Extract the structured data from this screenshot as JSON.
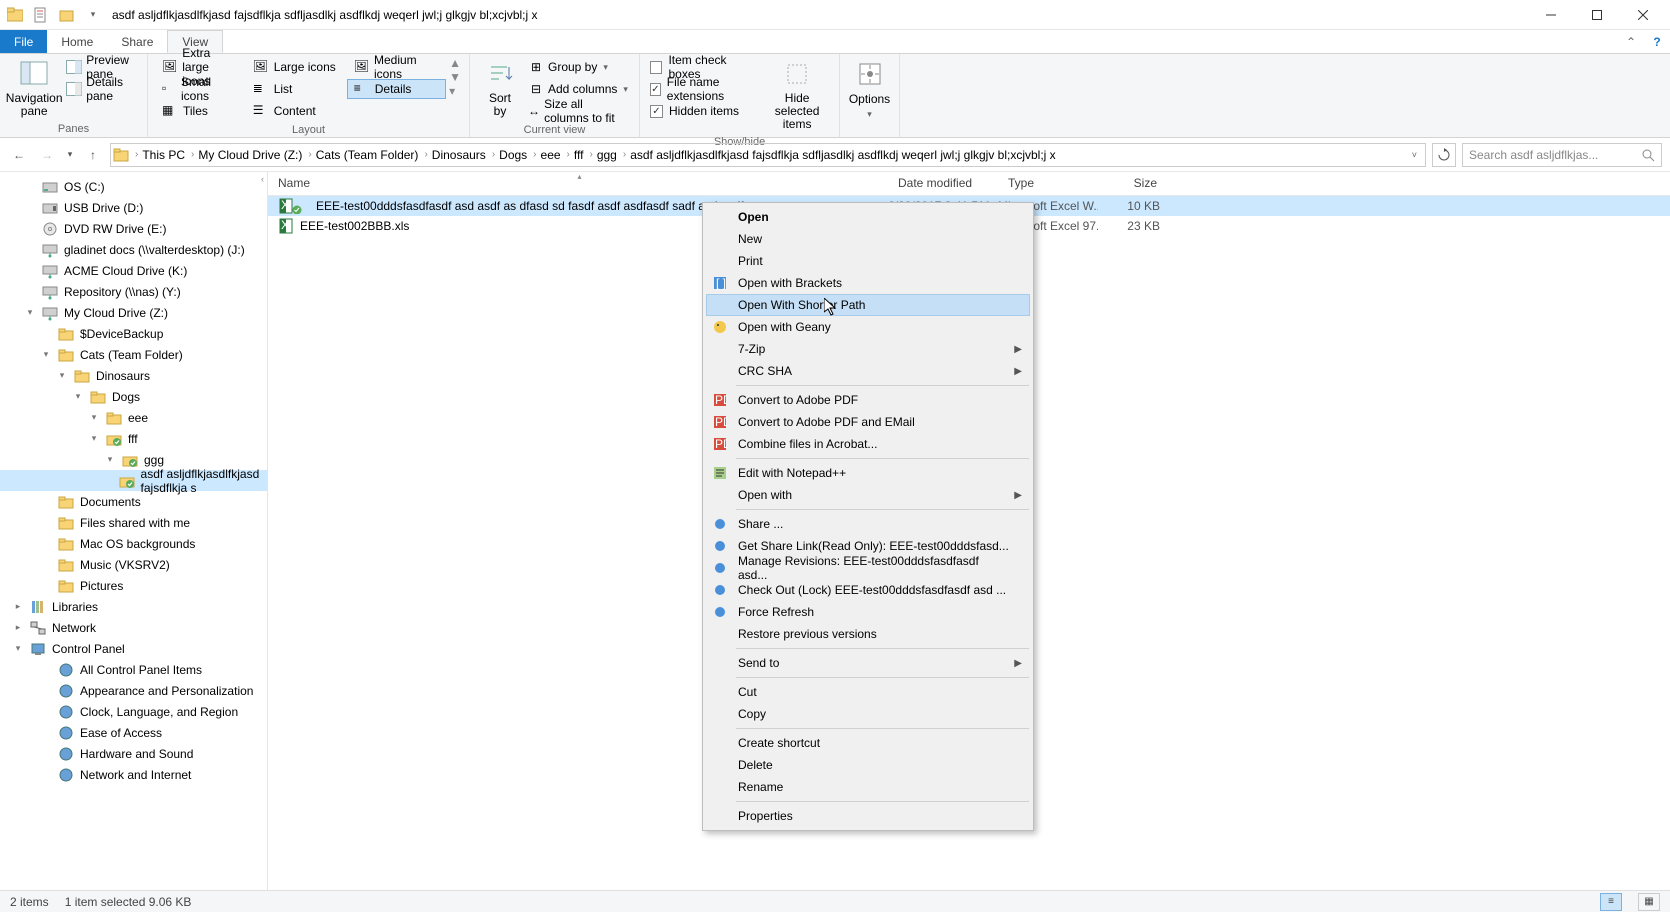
{
  "window": {
    "title": "asdf asljdflkjasdlfkjasd fajsdflkja sdfljasdlkj asdflkdj weqerl jwl;j glkgjv bl;xcjvbl;j x"
  },
  "tabs": {
    "file": "File",
    "home": "Home",
    "share": "Share",
    "view": "View"
  },
  "ribbon": {
    "panes_group": "Panes",
    "nav_pane": "Navigation\npane",
    "preview_pane": "Preview pane",
    "details_pane": "Details pane",
    "layout_group": "Layout",
    "layout": {
      "xl": "Extra large icons",
      "lg": "Large icons",
      "md": "Medium icons",
      "sm": "Small icons",
      "list": "List",
      "details": "Details",
      "tiles": "Tiles",
      "content": "Content"
    },
    "currentview_group": "Current view",
    "sortby": "Sort\nby",
    "groupby": "Group by",
    "addcolumns": "Add columns",
    "sizecols": "Size all columns to fit",
    "showhide_group": "Show/hide",
    "itemcheck": "Item check boxes",
    "fileext": "File name extensions",
    "hiddenitems": "Hidden items",
    "hidesel": "Hide selected\nitems",
    "options": "Options"
  },
  "breadcrumbs": [
    "This PC",
    "My Cloud Drive (Z:)",
    "Cats (Team Folder)",
    "Dinosaurs",
    "Dogs",
    "eee",
    "fff",
    "ggg",
    "asdf asljdflkjasdlfkjasd fajsdflkja sdfljasdlkj asdflkdj weqerl jwl;j glkgjv bl;xcjvbl;j x"
  ],
  "search_placeholder": "Search asdf asljdflkjas...",
  "tree": [
    {
      "indent": 24,
      "exp": "",
      "icon": "disk",
      "label": "OS (C:)"
    },
    {
      "indent": 24,
      "exp": "",
      "icon": "usb",
      "label": "USB Drive (D:)"
    },
    {
      "indent": 24,
      "exp": "",
      "icon": "dvd",
      "label": "DVD RW Drive (E:)"
    },
    {
      "indent": 24,
      "exp": "",
      "icon": "netdrive",
      "label": "gladinet docs (\\\\valterdesktop) (J:)"
    },
    {
      "indent": 24,
      "exp": "",
      "icon": "netdrive",
      "label": "ACME Cloud Drive (K:)"
    },
    {
      "indent": 24,
      "exp": "",
      "icon": "netdrive",
      "label": "Repository (\\\\nas) (Y:)"
    },
    {
      "indent": 24,
      "exp": "▾",
      "icon": "netdrive",
      "label": "My Cloud Drive (Z:)"
    },
    {
      "indent": 40,
      "exp": "",
      "icon": "folder",
      "label": "$DeviceBackup"
    },
    {
      "indent": 40,
      "exp": "▾",
      "icon": "folder",
      "label": "Cats (Team Folder)"
    },
    {
      "indent": 56,
      "exp": "▾",
      "icon": "folder",
      "label": "Dinosaurs"
    },
    {
      "indent": 72,
      "exp": "▾",
      "icon": "folder",
      "label": "Dogs"
    },
    {
      "indent": 88,
      "exp": "▾",
      "icon": "folder",
      "label": "eee"
    },
    {
      "indent": 88,
      "exp": "▾",
      "icon": "sync-folder",
      "label": "fff"
    },
    {
      "indent": 104,
      "exp": "▾",
      "icon": "sync-folder",
      "label": "ggg"
    },
    {
      "indent": 104,
      "exp": "",
      "icon": "sync-folder",
      "label": "asdf asljdflkjasdlfkjasd fajsdflkja s",
      "selected": true
    },
    {
      "indent": 40,
      "exp": "",
      "icon": "folder",
      "label": "Documents"
    },
    {
      "indent": 40,
      "exp": "",
      "icon": "folder",
      "label": "Files shared with me"
    },
    {
      "indent": 40,
      "exp": "",
      "icon": "folder",
      "label": "Mac OS backgrounds"
    },
    {
      "indent": 40,
      "exp": "",
      "icon": "folder",
      "label": "Music (VKSRV2)"
    },
    {
      "indent": 40,
      "exp": "",
      "icon": "folder",
      "label": "Pictures"
    },
    {
      "indent": 12,
      "exp": "▸",
      "icon": "libraries",
      "label": "Libraries"
    },
    {
      "indent": 12,
      "exp": "▸",
      "icon": "network",
      "label": "Network"
    },
    {
      "indent": 12,
      "exp": "▾",
      "icon": "cp",
      "label": "Control Panel"
    },
    {
      "indent": 40,
      "exp": "",
      "icon": "cp-item",
      "label": "All Control Panel Items"
    },
    {
      "indent": 40,
      "exp": "",
      "icon": "cp-item",
      "label": "Appearance and Personalization"
    },
    {
      "indent": 40,
      "exp": "",
      "icon": "cp-item",
      "label": "Clock, Language, and Region"
    },
    {
      "indent": 40,
      "exp": "",
      "icon": "cp-item",
      "label": "Ease of Access"
    },
    {
      "indent": 40,
      "exp": "",
      "icon": "cp-item",
      "label": "Hardware and Sound"
    },
    {
      "indent": 40,
      "exp": "",
      "icon": "cp-item",
      "label": "Network and Internet"
    }
  ],
  "columns": {
    "name": "Name",
    "date": "Date modified",
    "type": "Type",
    "size": "Size"
  },
  "files": [
    {
      "name": "EEE-test00dddsfasdfasdf asd asdf as dfasd  sd fasdf asdf asdfasdf sadf asd asdf zxcvz",
      "date": "6/20/2017 3:41 PM",
      "type": "Microsoft Excel W...",
      "size": "10 KB",
      "selected": true
    },
    {
      "name": "EEE-test002BBB.xls",
      "date": "",
      "type": "Microsoft Excel 97...",
      "size": "23 KB"
    }
  ],
  "context_menu": [
    {
      "label": "Open",
      "bold": true
    },
    {
      "label": "New"
    },
    {
      "label": "Print"
    },
    {
      "label": "Open with Brackets",
      "icon": "brackets"
    },
    {
      "label": "Open With Shorter Path",
      "hover": true
    },
    {
      "label": "Open with Geany",
      "icon": "geany"
    },
    {
      "label": "7-Zip",
      "submenu": true
    },
    {
      "label": "CRC SHA",
      "submenu": true
    },
    {
      "sep": true
    },
    {
      "label": "Convert to Adobe PDF",
      "icon": "pdf"
    },
    {
      "label": "Convert to Adobe PDF and EMail",
      "icon": "pdf"
    },
    {
      "label": "Combine files in Acrobat...",
      "icon": "pdf"
    },
    {
      "sep": true
    },
    {
      "label": "Edit with Notepad++",
      "icon": "npp"
    },
    {
      "label": "Open with",
      "submenu": true
    },
    {
      "sep": true
    },
    {
      "label": "Share ...",
      "icon": "blue"
    },
    {
      "label": "Get Share Link(Read Only): EEE-test00dddsfasd...",
      "icon": "blue"
    },
    {
      "label": "Manage Revisions: EEE-test00dddsfasdfasdf asd...",
      "icon": "blue"
    },
    {
      "label": "Check Out (Lock) EEE-test00dddsfasdfasdf asd ...",
      "icon": "blue"
    },
    {
      "label": "Force Refresh",
      "icon": "blue"
    },
    {
      "label": "Restore previous versions"
    },
    {
      "sep": true
    },
    {
      "label": "Send to",
      "submenu": true
    },
    {
      "sep": true
    },
    {
      "label": "Cut"
    },
    {
      "label": "Copy"
    },
    {
      "sep": true
    },
    {
      "label": "Create shortcut"
    },
    {
      "label": "Delete"
    },
    {
      "label": "Rename"
    },
    {
      "sep": true
    },
    {
      "label": "Properties"
    }
  ],
  "status": {
    "items": "2 items",
    "selected": "1 item selected  9.06 KB"
  }
}
